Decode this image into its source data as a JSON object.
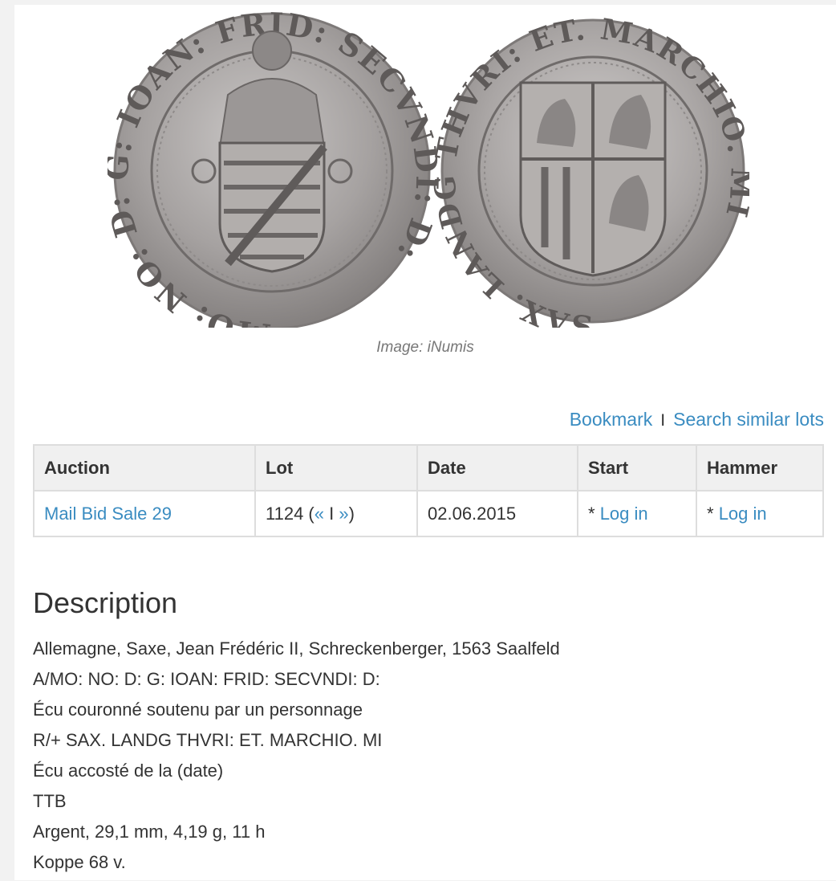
{
  "image_caption": "Image: iNumis",
  "coins": {
    "obverse_legend": "MO: NO: D: G: IOAN: FRID: SECVNDI: D:",
    "reverse_legend": "SAX. LANDG THVRI: ET. MARCHIO. MI"
  },
  "actions": {
    "bookmark": "Bookmark",
    "separator": "I",
    "search_similar": "Search similar lots"
  },
  "table": {
    "headers": [
      "Auction",
      "Lot",
      "Date",
      "Start",
      "Hammer"
    ],
    "row": {
      "auction": "Mail Bid Sale 29",
      "lot_number": "1124 (",
      "lot_prev": "«",
      "lot_sep": " I ",
      "lot_next": "»",
      "lot_close": ")",
      "date": "02.06.2015",
      "start_prefix": "* ",
      "start_link": "Log in",
      "hammer_prefix": "* ",
      "hammer_link": "Log in"
    }
  },
  "description": {
    "title": "Description",
    "lines": [
      "Allemagne, Saxe, Jean Frédéric II, Schreckenberger, 1563 Saalfeld",
      "A/MO: NO: D: G: IOAN: FRID: SECVNDI: D:",
      "Écu couronné soutenu par un personnage",
      "R/+ SAX. LANDG THVRI: ET. MARCHIO. MI",
      "Écu accosté de la (date)",
      "TTB",
      "Argent, 29,1 mm, 4,19 g, 11 h",
      "Koppe 68 v."
    ]
  },
  "colors": {
    "link": "#3a8cc1",
    "text": "#333333",
    "caption": "#777777",
    "table_header_bg": "#f0f0f0",
    "coin_silver": "#9a9696"
  }
}
